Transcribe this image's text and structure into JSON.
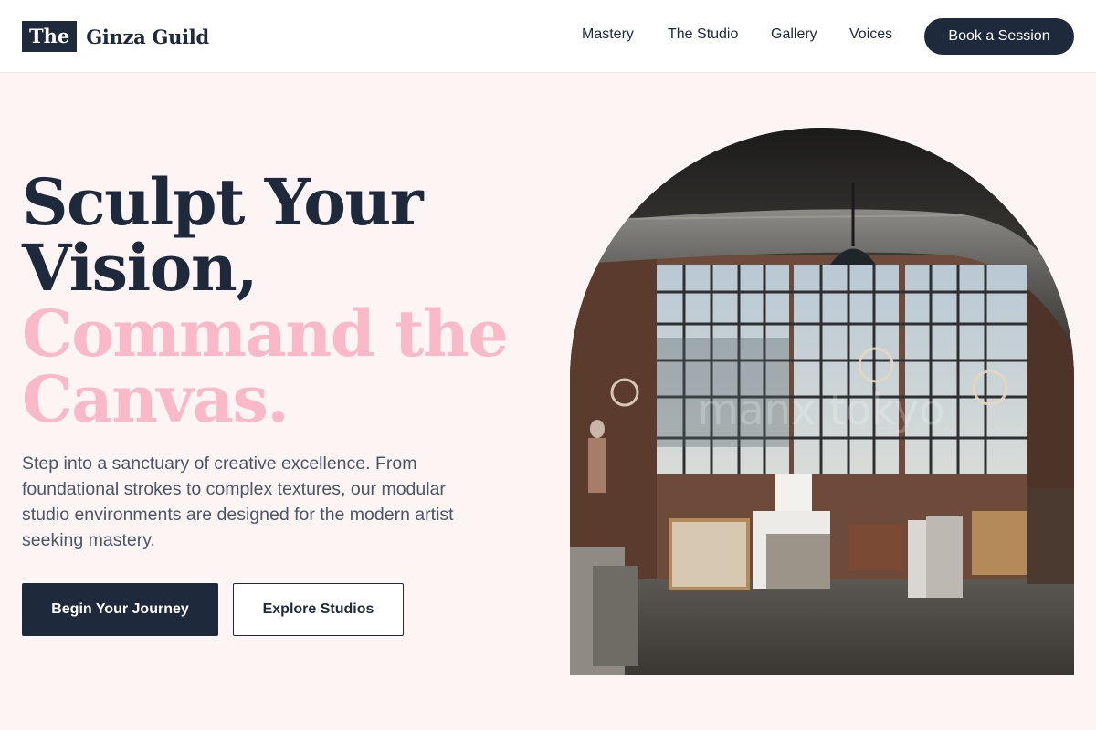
{
  "brand": {
    "mark": "The",
    "name": "Ginza Guild"
  },
  "nav": {
    "items": [
      {
        "label": "Mastery"
      },
      {
        "label": "The Studio"
      },
      {
        "label": "Gallery"
      },
      {
        "label": "Voices"
      }
    ],
    "cta": "Book a Session"
  },
  "hero": {
    "title_line1": "Sculpt Your",
    "title_line2": "Vision,",
    "title_line3": "Command the",
    "title_line4": "Canvas.",
    "description": "Step into a sanctuary of creative excellence. From foundational strokes to complex textures, our modular studio environments are designed for the modern artist seeking mastery.",
    "primary_button": "Begin Your Journey",
    "secondary_button": "Explore Studios",
    "image_watermark": "manx tokyo"
  },
  "colors": {
    "navy": "#1e293b",
    "pink": "#f9b9c9",
    "background": "#fdf4f4",
    "body_text": "#4a5568"
  }
}
